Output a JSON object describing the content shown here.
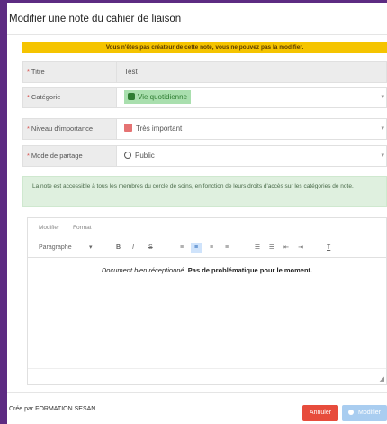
{
  "modal": {
    "title": "Modifier une note du cahier de liaison",
    "warning": "Vous n'êtes pas créateur de cette note, vous ne pouvez pas la modifier."
  },
  "form": {
    "required_marker": "*",
    "rows": [
      {
        "label": "Titre",
        "value": "Test"
      },
      {
        "label": "Catégorie",
        "value": "Vie quotidienne",
        "icon": "home-icon",
        "tag_color": "#a9dfae"
      },
      {
        "label": "Niveau d'importance",
        "value": "Très important",
        "icon": "flag-icon",
        "icon_color": "#e57373"
      },
      {
        "label": "Mode de partage",
        "value": "Public",
        "icon": "globe-icon"
      }
    ]
  },
  "info": {
    "text": "La note est accessible à tous les membres du cercle de soins, en fonction de leurs droits d'accès sur les catégories de note."
  },
  "editor": {
    "menu": [
      "Modifier",
      "Format"
    ],
    "paragraph": "Paragraphe",
    "toolbar_glyphs": {
      "bold": "B",
      "italic": "I",
      "strike": "S",
      "clear": "T"
    },
    "content": {
      "italic_part": "Document bien réceptionné.",
      "bold_part": "Pas de problématique pour le moment."
    }
  },
  "footer": {
    "created_by": "Crée par FORMATION SESAN",
    "cancel_label": "Annuler",
    "modify_label": "Modifier"
  },
  "colors": {
    "frame": "#5d2b82",
    "warning_bg": "#f5c400",
    "cancel_bg": "#e74c3c",
    "modify_bg": "#a9cdf0",
    "info_bg": "#dff0df"
  }
}
